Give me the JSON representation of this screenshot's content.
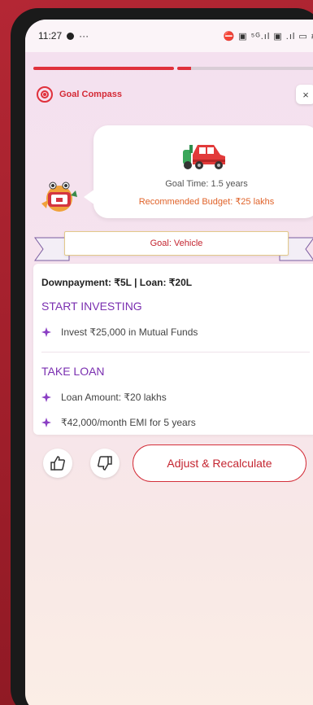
{
  "status": {
    "time": "11:27",
    "indicators": "⛔ ▣ ⁵ᴳ.ıl ▣ .ıl ▭ #",
    "notification_icon": "record-dot",
    "ellipsis": "···"
  },
  "progress": {
    "segments": [
      1.0,
      0.1
    ]
  },
  "header": {
    "app_name": "Goal Compass",
    "close_label": "×"
  },
  "summary": {
    "goal_time": "Goal Time: 1.5 years",
    "recommended_budget": "Recommended Budget: ₹25 lakhs"
  },
  "goal": {
    "ribbon_label": "Goal: Vehicle"
  },
  "plan": {
    "headline": "Downpayment: ₹5L | Loan: ₹20L",
    "sections": [
      {
        "title": "START INVESTING",
        "items": [
          "Invest ₹25,000 in Mutual Funds"
        ]
      },
      {
        "title": "TAKE LOAN",
        "items": [
          "Loan Amount: ₹20 lakhs",
          "₹42,000/month EMI for 5 years"
        ]
      }
    ]
  },
  "actions": {
    "recalculate_label": "Adjust & Recalculate"
  },
  "colors": {
    "accent": "#e0313c",
    "section": "#7a2fb0",
    "budget": "#e0632a",
    "background": "#a3202c"
  }
}
